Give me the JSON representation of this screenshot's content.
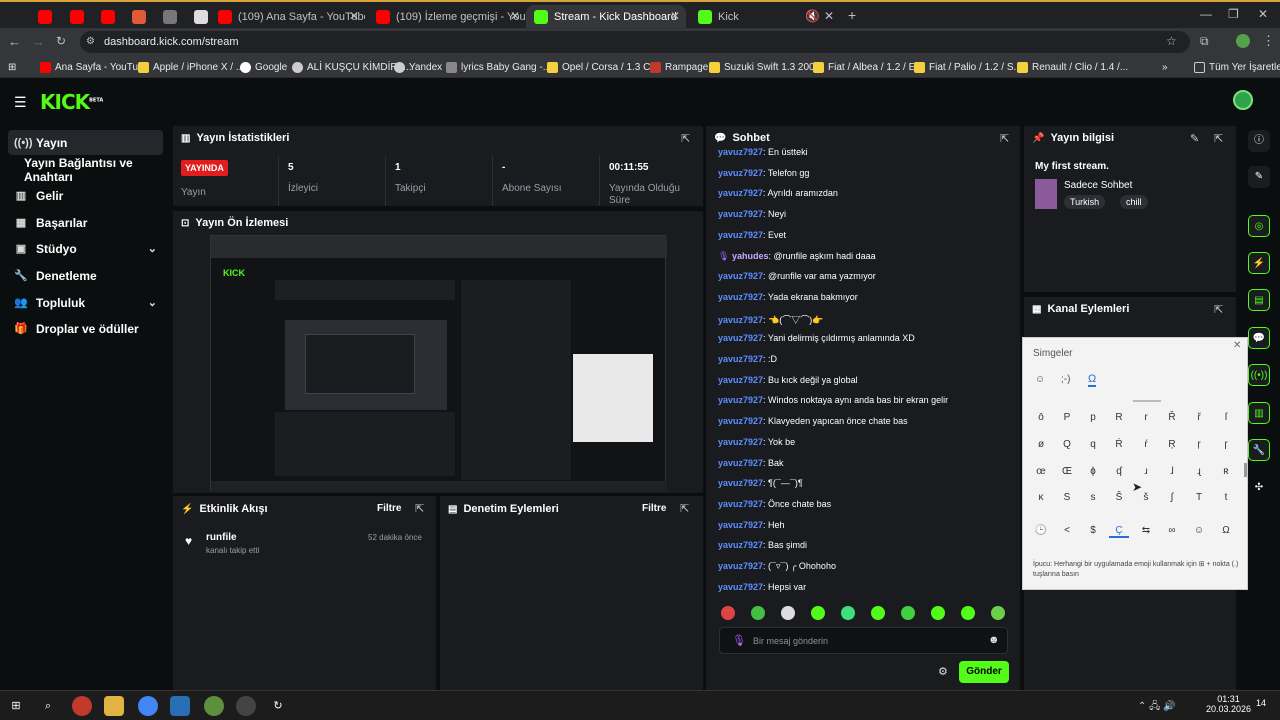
{
  "browser": {
    "tabs": [
      {
        "label": ""
      },
      {
        "label": ""
      },
      {
        "label": ""
      },
      {
        "label": ""
      },
      {
        "label": ""
      },
      {
        "label": "(109) Ana Sayfa - YouTube"
      },
      {
        "label": "(109) İzleme geçmişi - YouTube"
      },
      {
        "label": "Stream - Kick Dashboard"
      },
      {
        "label": "Kick"
      }
    ],
    "url": "dashboard.kick.com/stream",
    "bookmarks": [
      "Ana Sayfa - YouTube",
      "Apple / iPhone X / ...",
      "Google",
      "ALİ KUŞÇU KİMDİR?...",
      "Yandex",
      "lyrics Baby Gang -...",
      "Opel / Corsa / 1.3 C...",
      "Rampage",
      "Suzuki Swift 1.3 200...",
      "Fiat / Albea / 1.2 / E...",
      "Fiat / Palio / 1.2 / S...",
      "Renault / Clio / 1.4 /..."
    ],
    "all_bookmarks": "Tüm Yer İşaretleri",
    "colors": {
      "accent": "#53fc18",
      "youtube": "#ff0000"
    }
  },
  "kick": {
    "logo": "KICK",
    "logo_sup": "BETA"
  },
  "sidebar": {
    "items": [
      {
        "label": "Yayın",
        "icon": "broadcast-icon"
      },
      {
        "label": "Yayın Bağlantısı ve Anahtarı",
        "icon": ""
      },
      {
        "label": "Gelir",
        "icon": "chart-icon"
      },
      {
        "label": "Başarılar",
        "icon": "trophy-icon"
      },
      {
        "label": "Stüdyo",
        "icon": "studio-icon"
      },
      {
        "label": "Denetleme",
        "icon": "wrench-icon"
      },
      {
        "label": "Topluluk",
        "icon": "people-icon"
      },
      {
        "label": "Droplar ve ödüller",
        "icon": "gift-icon"
      }
    ]
  },
  "stats": {
    "title": "Yayın İstatistikleri",
    "live_badge": "YAYINDA",
    "live_label": "Yayın",
    "viewers": "5",
    "viewers_label": "İzleyici",
    "followers": "1",
    "followers_label": "Takipçi",
    "subs": "-",
    "subs_label": "Abone Sayısı",
    "duration": "00:11:55",
    "duration_label": "Yayında Olduğu Süre"
  },
  "preview": {
    "title": "Yayın Ön İzlemesi"
  },
  "activity": {
    "title": "Etkinlik Akışı",
    "filter": "Filtre",
    "events": [
      {
        "user": "runfile",
        "text": "kanalı takip etti",
        "time": "52 dakika önce"
      }
    ]
  },
  "moderation": {
    "title": "Denetim Eylemleri",
    "filter": "Filtre"
  },
  "chat": {
    "title": "Sohbet",
    "messages": [
      {
        "user": "yavuz7927",
        "text": ": En üstteki"
      },
      {
        "user": "yavuz7927",
        "text": ": Telefon gg"
      },
      {
        "user": "yavuz7927",
        "text": ": Ayrıldı aramızdan"
      },
      {
        "user": "yavuz7927",
        "text": ": Neyi"
      },
      {
        "user": "yavuz7927",
        "text": ": Evet"
      },
      {
        "user": "yahudes",
        "text": ": @runfile aşkım hadi daaa"
      },
      {
        "user": "yavuz7927",
        "text": ": @runfile var ama yazmıyor"
      },
      {
        "user": "yavuz7927",
        "text": ": Yada ekrana bakmıyor"
      },
      {
        "user": "yavuz7927",
        "text": ": 👈(⌒▽⌒)👉"
      },
      {
        "user": "yavuz7927",
        "text": ": Yani delirmiş çıldırmış anlamında XD"
      },
      {
        "user": "yavuz7927",
        "text": ": :D"
      },
      {
        "user": "yavuz7927",
        "text": ": Bu kıck değil ya global"
      },
      {
        "user": "yavuz7927",
        "text": ": Windos noktaya aynı anda bas bir ekran gelir"
      },
      {
        "user": "yavuz7927",
        "text": ": Klavyeden yapıcan önce chate bas"
      },
      {
        "user": "yavuz7927",
        "text": ": Yok be"
      },
      {
        "user": "yavuz7927",
        "text": ": Bak"
      },
      {
        "user": "yavuz7927",
        "text": ": ¶(¯—¯)¶"
      },
      {
        "user": "yavuz7927",
        "text": ": Önce chate bas"
      },
      {
        "user": "yavuz7927",
        "text": ": Heh"
      },
      {
        "user": "yavuz7927",
        "text": ": Bas şimdi"
      },
      {
        "user": "yavuz7927",
        "text": ": (¯▿¯) ╭ Ohohoho"
      },
      {
        "user": "yavuz7927",
        "text": ": Hepsi var"
      }
    ],
    "input_placeholder": "Bir mesaj gönderin",
    "send_label": "Gönder"
  },
  "stream_info": {
    "title": "Yayın bilgisi",
    "stream_title": "My first stream.",
    "category": "Sadece Sohbet",
    "tags": [
      "Turkish",
      "chill"
    ]
  },
  "channel_actions": {
    "title": "Kanal Eylemleri"
  },
  "symbols": {
    "title": "Simgeler",
    "rows": [
      [
        "ō",
        "P",
        "p",
        "R",
        "r",
        "Ř",
        "ř",
        "ſ"
      ],
      [
        "ø",
        "Q",
        "q",
        "Ŕ",
        "ŕ",
        "Ŗ",
        "ŗ",
        "ɼ"
      ],
      [
        "œ",
        "Œ",
        "ɸ",
        "ʠ",
        "ɹ",
        "ɺ",
        "ɻ",
        "ʀ"
      ],
      [
        "ĸ",
        "S",
        "s",
        "Š",
        "š",
        "ʃ",
        "T",
        "t"
      ],
      [
        "🕒",
        "<",
        "$",
        "Ç",
        "⇆",
        "∞",
        "☺",
        "Ω"
      ]
    ],
    "hint": "İpucu: Herhangi bir uygulamada emoji kullanmak için ⊞ + nokta (.) tuşlarına basın"
  },
  "taskbar": {
    "time": "01:31",
    "date": "20.03.2026",
    "notif": "14"
  }
}
